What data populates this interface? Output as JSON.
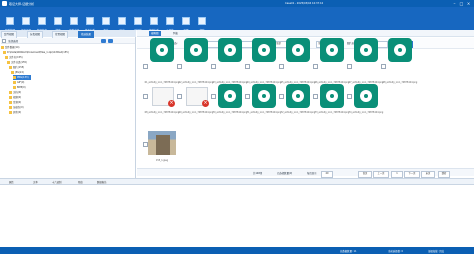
{
  "app": {
    "title": "取证大师-证据分析",
    "window_info": "Case01 - 2025/03/04 10:37:10"
  },
  "ribbon": [
    {
      "label": "案件管理",
      "icon": "case-icon"
    },
    {
      "label": "添加证据",
      "icon": "add-evidence-icon"
    },
    {
      "label": "数据恢复",
      "icon": "recovery-icon"
    },
    {
      "label": "搜索",
      "icon": "search-icon"
    },
    {
      "label": "文件过滤",
      "icon": "filter-icon"
    },
    {
      "label": "签名分析",
      "icon": "signature-icon"
    },
    {
      "label": "报告",
      "icon": "report-icon"
    },
    {
      "label": "导出",
      "icon": "export-icon"
    },
    {
      "label": "时间线",
      "icon": "timeline-icon"
    },
    {
      "label": "关联分析",
      "icon": "link-icon"
    },
    {
      "label": "工具集",
      "icon": "tools-icon"
    },
    {
      "label": "设置",
      "icon": "gear-icon"
    },
    {
      "label": "帮助",
      "icon": "help-icon"
    }
  ],
  "left_tabs": [
    {
      "label": "案件视图",
      "active": false
    },
    {
      "label": "分类视图",
      "active": false
    },
    {
      "label": "位置视图",
      "active": false
    },
    {
      "label": "筛选结果",
      "active": true
    }
  ],
  "left_toolbar": {
    "label": "全部选择"
  },
  "tree": [
    {
      "label": "案件数据(14)",
      "indent": 0
    },
    {
      "label": "D:\\Data\\WeWork\\Download\\files_1.zip\\Untitled(155)",
      "indent": 2
    },
    {
      "label": "文件夹(155)",
      "indent": 4
    },
    {
      "label": "文件分类(155)",
      "indent": 6
    },
    {
      "label": "图片(155)",
      "indent": 8
    },
    {
      "label": "JPG(22)",
      "indent": 10
    },
    {
      "label": "PNG(133)",
      "indent": 12
    },
    {
      "label": "GIF(0)",
      "indent": 12
    },
    {
      "label": "BMP(0)",
      "indent": 12
    },
    {
      "label": "文档(0)",
      "indent": 8
    },
    {
      "label": "视频(0)",
      "indent": 8
    },
    {
      "label": "音频(0)",
      "indent": 8
    },
    {
      "label": "压缩包(0)",
      "indent": 8
    },
    {
      "label": "其他(0)",
      "indent": 8
    }
  ],
  "tree_selected": "PNG(133)",
  "right_tabs": [
    "缩略图",
    "列表"
  ],
  "filter": {
    "label1": "筛选:",
    "field1": "按修改时间",
    "label2": "时间:",
    "field2": "全部",
    "label3": "图片类型:",
    "field3": "全部",
    "label4": "图片大小:",
    "field4": "全部",
    "label5": "图片来源:",
    "field5": "全部",
    "button": "搜索"
  },
  "thumbs_row1": [
    {
      "caption": "61_activity_icon_74875d4d.png",
      "type": "partial"
    },
    {
      "caption": "62_activity_icon_74875d4d.png",
      "type": "partial"
    },
    {
      "caption": "63_activity_icon_74875d4d.png",
      "type": "partial"
    },
    {
      "caption": "64_activity_icon_74875d4d.png",
      "type": "partial"
    },
    {
      "caption": "65_activity_icon_74875d4d.png",
      "type": "partial"
    },
    {
      "caption": "66_activity_icon_74875d4d.png",
      "type": "partial"
    },
    {
      "caption": "67_activity_icon_74875d4d.png",
      "type": "partial"
    },
    {
      "caption": "68_activity_icon_74875d4d.png",
      "type": "partial"
    }
  ],
  "thumbs_row2": [
    {
      "caption": "68_activity_icon_74875d4d.png",
      "type": "broken"
    },
    {
      "caption": "69_activity_icon_74875d4d.png",
      "type": "broken"
    },
    {
      "caption": "70_activity_icon_74875d4d.png",
      "type": "gear"
    },
    {
      "caption": "71_activity_icon_74875d4d.png",
      "type": "gear"
    },
    {
      "caption": "72_activity_icon_74875d4d.png",
      "type": "gear"
    },
    {
      "caption": "73_activity_icon_74875d4d.png",
      "type": "gear"
    },
    {
      "caption": "74_activity_icon_74875d4d.png",
      "type": "gear"
    }
  ],
  "thumbs_row3": [
    {
      "caption": "155_1.jpeg",
      "type": "photo"
    }
  ],
  "pager": {
    "total": "共148条",
    "selected": "已选择数量(0)",
    "per_page": "每页显示",
    "per_page_value": "40",
    "first": "首页",
    "prev": "上一页",
    "next": "下一页",
    "last": "末页",
    "page": "1",
    "go": "跳转"
  },
  "bottom_tabs": [
    "属性",
    "文本",
    "十六进制",
    "预览",
    "数据报告"
  ],
  "status": {
    "left": "",
    "mid": "当前选择: 0",
    "right1": "总数据数量: 11",
    "right2": "当前选择数: 0",
    "right3": "证据加载: 完成"
  },
  "colors": {
    "accent": "#0b5fb3",
    "ribbon": "#1767c0",
    "icon_green": "#0a8f78",
    "error": "#d9362b"
  }
}
